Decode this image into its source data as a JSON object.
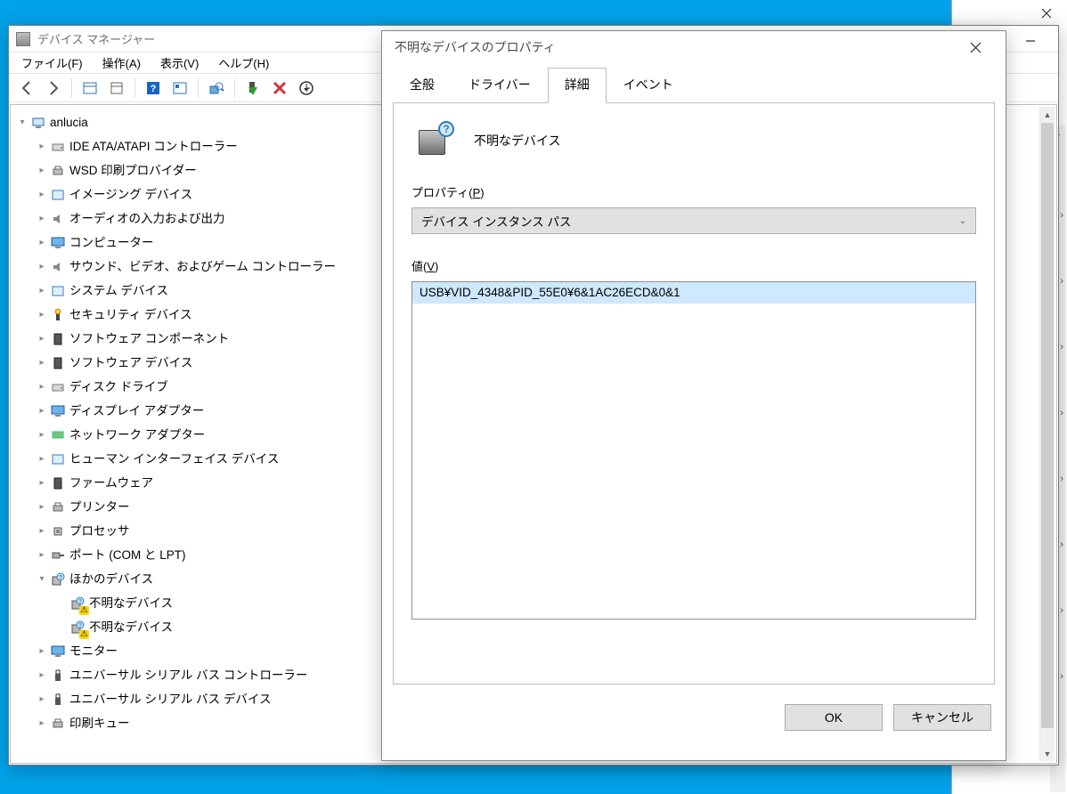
{
  "devmgr": {
    "title": "デバイス マネージャー",
    "menus": {
      "file": "ファイル(F)",
      "action": "操作(A)",
      "view": "表示(V)",
      "help": "ヘルプ(H)"
    },
    "computer_name": "anlucia",
    "categories": [
      {
        "label": "IDE ATA/ATAPI コントローラー",
        "icon": "ide"
      },
      {
        "label": "WSD 印刷プロバイダー",
        "icon": "printer"
      },
      {
        "label": "イメージング デバイス",
        "icon": "imaging"
      },
      {
        "label": "オーディオの入力および出力",
        "icon": "audio"
      },
      {
        "label": "コンピューター",
        "icon": "monitor"
      },
      {
        "label": "サウンド、ビデオ、およびゲーム コントローラー",
        "icon": "audio"
      },
      {
        "label": "システム デバイス",
        "icon": "system"
      },
      {
        "label": "セキュリティ デバイス",
        "icon": "security"
      },
      {
        "label": "ソフトウェア コンポーネント",
        "icon": "software"
      },
      {
        "label": "ソフトウェア デバイス",
        "icon": "software"
      },
      {
        "label": "ディスク ドライブ",
        "icon": "disk"
      },
      {
        "label": "ディスプレイ アダプター",
        "icon": "display"
      },
      {
        "label": "ネットワーク アダプター",
        "icon": "network"
      },
      {
        "label": "ヒューマン インターフェイス デバイス",
        "icon": "hid"
      },
      {
        "label": "ファームウェア",
        "icon": "firmware"
      },
      {
        "label": "プリンター",
        "icon": "printer"
      },
      {
        "label": "プロセッサ",
        "icon": "cpu"
      },
      {
        "label": "ポート (COM と LPT)",
        "icon": "port"
      }
    ],
    "other_devices": {
      "label": "ほかのデバイス",
      "children": [
        {
          "label": "不明なデバイス"
        },
        {
          "label": "不明なデバイス"
        }
      ]
    },
    "after_other": [
      {
        "label": "モニター",
        "icon": "monitor"
      },
      {
        "label": "ユニバーサル シリアル バス コントローラー",
        "icon": "usb"
      },
      {
        "label": "ユニバーサル シリアル バス デバイス",
        "icon": "usb"
      },
      {
        "label": "印刷キュー",
        "icon": "printer"
      }
    ]
  },
  "props": {
    "title": "不明なデバイスのプロパティ",
    "tabs": {
      "general": "全般",
      "driver": "ドライバー",
      "details": "詳細",
      "events": "イベント"
    },
    "device_name": "不明なデバイス",
    "property_label_pre": "プロパティ(",
    "property_label_key": "P",
    "property_label_post": ")",
    "property_value": "デバイス インスタンス パス",
    "value_label_pre": "値(",
    "value_label_key": "V",
    "value_label_post": ")",
    "value": "USB¥VID_4348&PID_55E0¥6&1AC26ECD&0&1",
    "ok": "OK",
    "cancel": "キャンセル"
  }
}
